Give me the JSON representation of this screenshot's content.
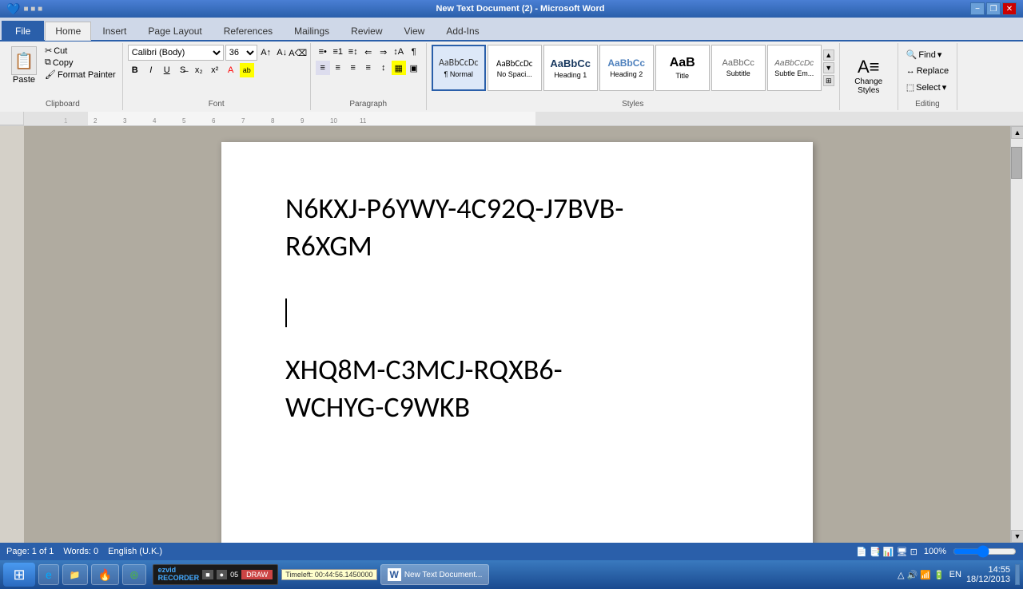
{
  "titlebar": {
    "title": "New Text Document (2) - Microsoft Word",
    "min": "−",
    "restore": "❐",
    "close": "✕"
  },
  "tabs": [
    {
      "label": "File",
      "type": "file"
    },
    {
      "label": "Home",
      "type": "active"
    },
    {
      "label": "Insert",
      "type": "normal"
    },
    {
      "label": "Page Layout",
      "type": "normal"
    },
    {
      "label": "References",
      "type": "normal"
    },
    {
      "label": "Mailings",
      "type": "normal"
    },
    {
      "label": "Review",
      "type": "normal"
    },
    {
      "label": "View",
      "type": "normal"
    },
    {
      "label": "Add-Ins",
      "type": "normal"
    }
  ],
  "clipboard": {
    "paste": "Paste",
    "cut": "Cut",
    "copy": "Copy",
    "format_painter": "Format Painter",
    "label": "Clipboard"
  },
  "font": {
    "name": "Calibri (Body)",
    "size": "36",
    "label": "Font"
  },
  "paragraph": {
    "label": "Paragraph"
  },
  "styles": {
    "label": "Styles",
    "items": [
      {
        "name": "Normal",
        "preview": "AaBbCcDc",
        "active": true
      },
      {
        "name": "No Spaci...",
        "preview": "AaBbCcDc"
      },
      {
        "name": "Heading 1",
        "preview": "AaBbCc"
      },
      {
        "name": "Heading 2",
        "preview": "AaBbCc"
      },
      {
        "name": "Title",
        "preview": "AaB"
      },
      {
        "name": "Subtitle",
        "preview": "AaBbCc"
      },
      {
        "name": "Subtle Em...",
        "preview": "AaBbCcDc"
      }
    ],
    "change_styles": "Change\nStyles"
  },
  "editing": {
    "find": "Find",
    "replace": "Replace",
    "select": "Select",
    "label": "Editing"
  },
  "document": {
    "line1": "N6KXJ-P6YWY-4C92Q-J7BVB-",
    "line2": "R6XGM",
    "line3": "XHQ8M-C3MCJ-RQXB6-",
    "line4": "WCHYG-C9WKB"
  },
  "statusbar": {
    "page": "Page: 1 of 1",
    "words": "Words: 0",
    "lang": "English (U.K.)",
    "zoom": "100%",
    "time": "14:55",
    "date": "18/12/2013"
  },
  "taskbar": {
    "start": "⊞",
    "items": [
      {
        "label": "IE",
        "icon": "e"
      },
      {
        "label": "Explorer",
        "icon": "📁"
      },
      {
        "label": "Firefox",
        "icon": "🌐"
      },
      {
        "label": "Chrome",
        "icon": "⊕"
      },
      {
        "label": "Word",
        "icon": "W",
        "active": true
      }
    ]
  },
  "ezvid": {
    "logo": "ezvid\nRECORDER",
    "stop": "■",
    "draw": "DRAW",
    "tooltip": "Timeleft: 00:44:56.1450000"
  }
}
